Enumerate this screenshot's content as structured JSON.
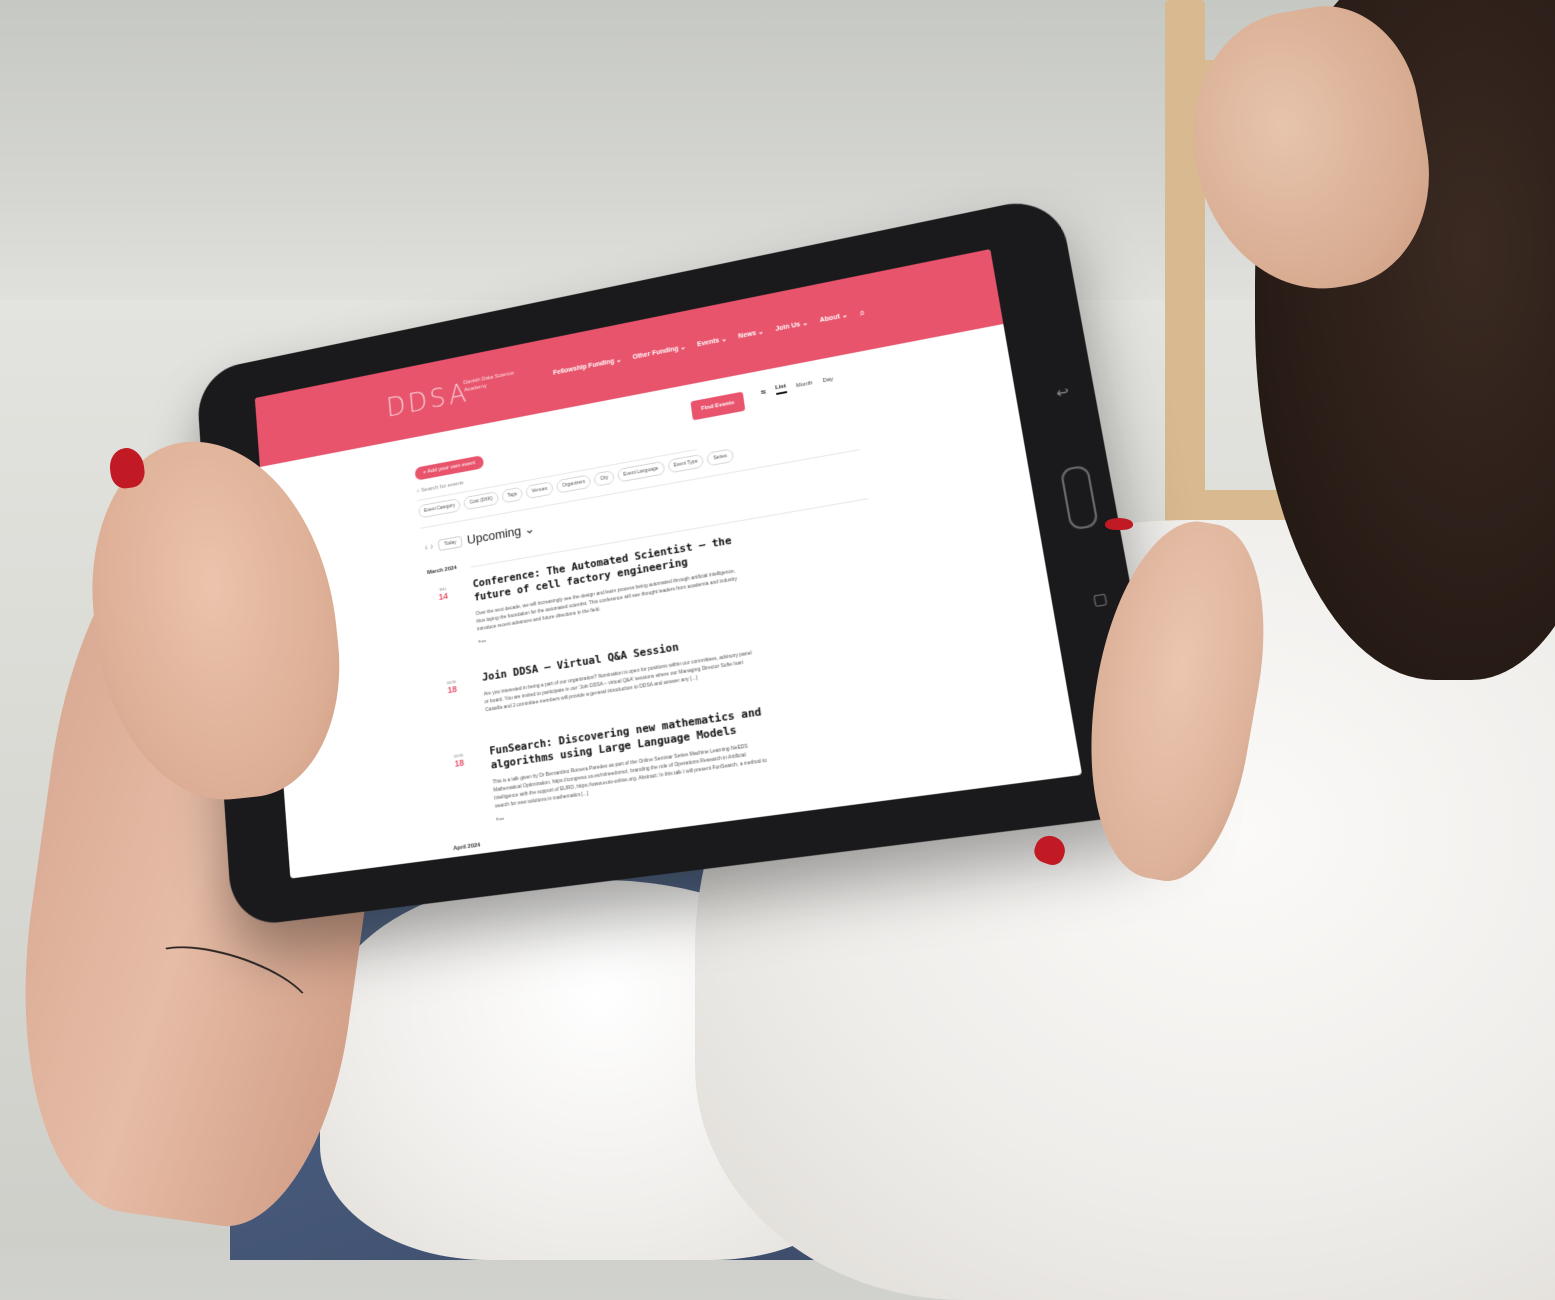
{
  "site": {
    "logo": "DDSA",
    "logo_subtitle": "Danish Data Science Academy",
    "brand_color": "#e9546d",
    "nav": [
      "Fellowship Funding ⌄",
      "Other Funding ⌄",
      "Events ⌄",
      "News ⌄",
      "Join Us ⌄",
      "About ⌄"
    ],
    "search_icon": "search-icon"
  },
  "toolbar": {
    "add_event": "+ Add your own event",
    "search_placeholder": "Search for events",
    "find_events": "Find Events",
    "views": [
      "List",
      "Month",
      "Day"
    ],
    "active_view": "List"
  },
  "filters": [
    "Event Category",
    "Cost (DKK)",
    "Tags",
    "Venues",
    "Organizers",
    "City",
    "Event Language",
    "Event Type",
    "Series"
  ],
  "list_nav": {
    "today": "Today",
    "heading": "Upcoming ⌄"
  },
  "months": {
    "march": "March 2024",
    "april": "April 2024"
  },
  "events": [
    {
      "dow": "THU",
      "day": "14",
      "title": "Conference: The Automated Scientist – the future of cell factory engineering",
      "description": "Over the next decade, we will increasingly see the design and learn process being automated through artificial intelligence, thus laying the foundation for the automated scientist. This conference will see thought leaders from academia and industry introduce recent advances and future directions in the field.",
      "cost": "Free"
    },
    {
      "dow": "MON",
      "day": "18",
      "title": "Join DDSA – Virtual Q&A Session",
      "description": "Are you interested in being a part of our organization? Nomination is open for positions within our committees, advisory panel or board. You are invited to participate in our 'Join DDSA – virtual Q&A' sessions where our Managing Director Sofie Ivari Castella and 2 committee members will provide a general introduction to DDSA and answer any [...]",
      "cost": ""
    },
    {
      "dow": "MON",
      "day": "18",
      "title": "FunSearch: Discovering new mathematics and algorithms using Large Language Models",
      "description": "This is a talk given by Dr Bernardino Romera Paredes as part of the Online Seminar Series Machine Learning NeEDS Mathematical Optimization, https://congreso.us.es/mlneedsmo/, branding the role of Operations Research in Artificial Intelligence with the support of EURO, https://www.euro-online.org. Abstract: In this talk I will present FunSearch, a method to search for new solutions in mathematics [...]",
      "cost": "Free"
    }
  ]
}
